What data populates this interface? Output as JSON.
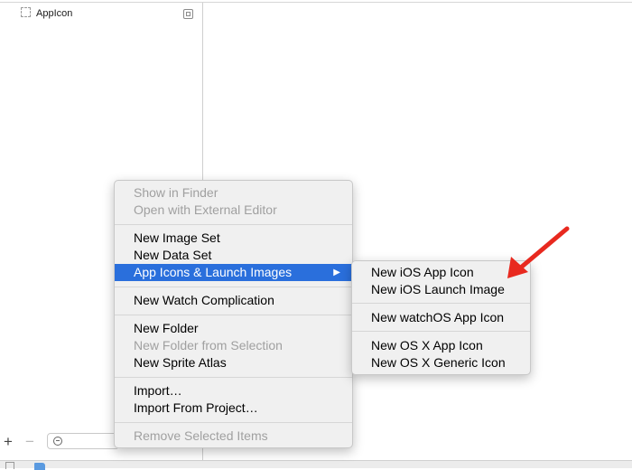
{
  "asset_list": {
    "items": [
      {
        "label": "AppIcon"
      }
    ]
  },
  "toolbar": {
    "add": "+",
    "remove": "−"
  },
  "context_menu": {
    "items": [
      {
        "label": "Show in Finder",
        "enabled": false
      },
      {
        "label": "Open with External Editor",
        "enabled": false
      },
      {
        "label": "New Image Set",
        "enabled": true
      },
      {
        "label": "New Data Set",
        "enabled": true
      },
      {
        "label": "App Icons & Launch Images",
        "enabled": true,
        "highlighted": true,
        "has_submenu": true
      },
      {
        "label": "New Watch Complication",
        "enabled": true
      },
      {
        "label": "New Folder",
        "enabled": true
      },
      {
        "label": "New Folder from Selection",
        "enabled": false
      },
      {
        "label": "New Sprite Atlas",
        "enabled": true
      },
      {
        "label": "Import…",
        "enabled": true
      },
      {
        "label": "Import From Project…",
        "enabled": true
      },
      {
        "label": "Remove Selected Items",
        "enabled": false
      }
    ],
    "submenu_arrow": "▶"
  },
  "submenu": {
    "items": [
      {
        "label": "New iOS App Icon"
      },
      {
        "label": "New iOS Launch Image"
      },
      {
        "label": "New watchOS App Icon"
      },
      {
        "label": "New OS X App Icon"
      },
      {
        "label": "New OS X Generic Icon"
      }
    ]
  },
  "colors": {
    "highlight": "#2a6fdc",
    "annotation_arrow": "#e8291f",
    "disabled_text": "#a0a0a0"
  }
}
